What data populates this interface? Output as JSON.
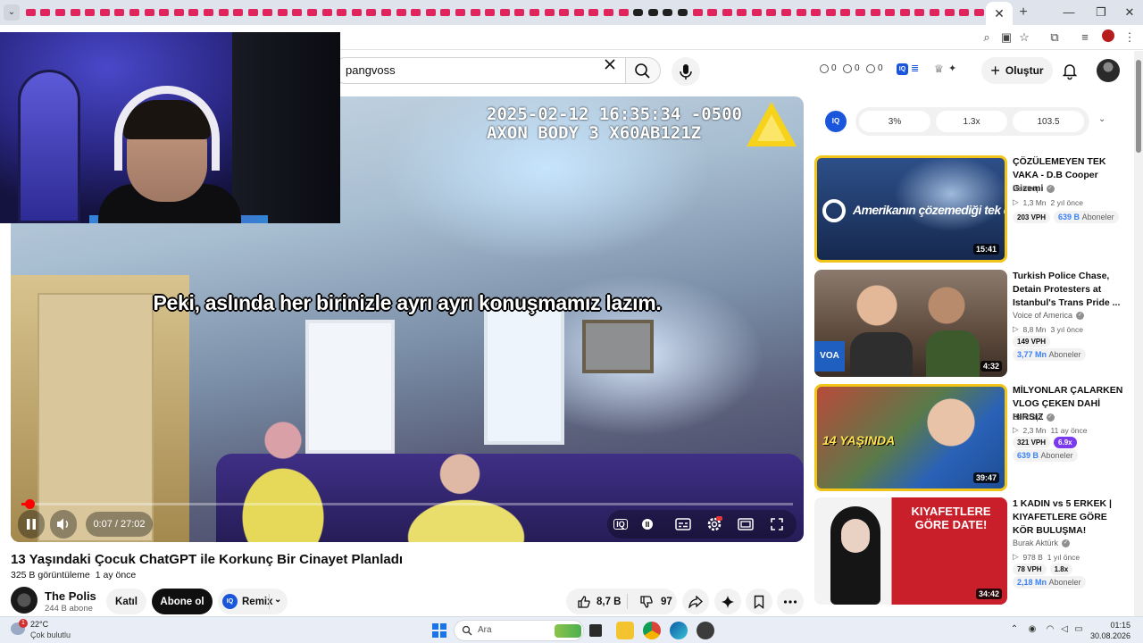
{
  "browser": {
    "active_tab_close": "✕",
    "new_tab": "+",
    "window_controls": [
      "—",
      "❐",
      "✕"
    ]
  },
  "masthead": {
    "search_value": "pangvoss",
    "stats": [
      "0",
      "0",
      "0"
    ],
    "create_label": "Oluştur"
  },
  "player": {
    "overlay_timestamp": "2025-02-12 16:35:34 -0500\nAXON BODY 3 X60AB121Z",
    "caption": "Peki, aslında her birinizle ayrı ayrı konuşmamız lazım.",
    "time": "0:07 / 27:02",
    "progress_fraction": 0.0043,
    "iq_badge": "IQ"
  },
  "video": {
    "title": "13 Yaşındaki Çocuk ChatGPT ile Korkunç Bir Cinayet Planladı",
    "views": "325 B görüntüleme",
    "age": "1 ay önce",
    "channel_name": "The Polis",
    "channel_subs": "244 B abone",
    "join_label": "Katıl",
    "subscribe_label": "Abone ol",
    "remix_label": "Remix",
    "likes": "8,7 B",
    "dislikes": "97"
  },
  "iq_panel": {
    "logo": "IQ",
    "stats": [
      "3%",
      "1.3x",
      "103.5"
    ]
  },
  "recommendations": [
    {
      "title": "ÇÖZÜLEMEYEN TEK VAKA - D.B Cooper Gizemi",
      "channel": "Bentropi",
      "views": "1,3 Mn",
      "age": "2 yıl önce",
      "vph": "203 VPH",
      "mult": "",
      "subs_value": "639 B",
      "subs_label": "Aboneler",
      "duration": "15:41",
      "thumb_text": "Amerikanın çözemediği tek dava"
    },
    {
      "title": "Turkish Police Chase, Detain Protesters at Istanbul's Trans Pride ...",
      "channel": "Voice of America",
      "views": "8,8 Mn",
      "age": "3 yıl önce",
      "vph": "149 VPH",
      "mult": "",
      "subs_value": "3,77 Mn",
      "subs_label": "Aboneler",
      "duration": "4:32",
      "thumb_text": "VOA"
    },
    {
      "title": "MİLYONLAR ÇALARKEN VLOG ÇEKEN DAHİ HIRSIZ",
      "channel": "Bentropi",
      "views": "2,3 Mn",
      "age": "11 ay önce",
      "vph": "321 VPH",
      "mult": "6.9x",
      "subs_value": "639 B",
      "subs_label": "Aboneler",
      "duration": "39:47",
      "thumb_text": "14 YAŞINDA"
    },
    {
      "title": "1 KADIN vs 5 ERKEK | KIYAFETLERE GÖRE KÖR BULUŞMA!",
      "channel": "Burak Aktürk",
      "views": "978 B",
      "age": "1 yıl önce",
      "vph": "78 VPH",
      "mult": "1.8x",
      "subs_value": "2,18 Mn",
      "subs_label": "Aboneler",
      "duration": "34:42",
      "thumb_text": "KIYAFETLERE GÖRE DATE!"
    }
  ],
  "taskbar": {
    "temp": "22°C",
    "condition": "Çok bulutlu",
    "alert": "1",
    "search_label": "Ara",
    "time": "01:15",
    "date": "30.08.2026"
  }
}
